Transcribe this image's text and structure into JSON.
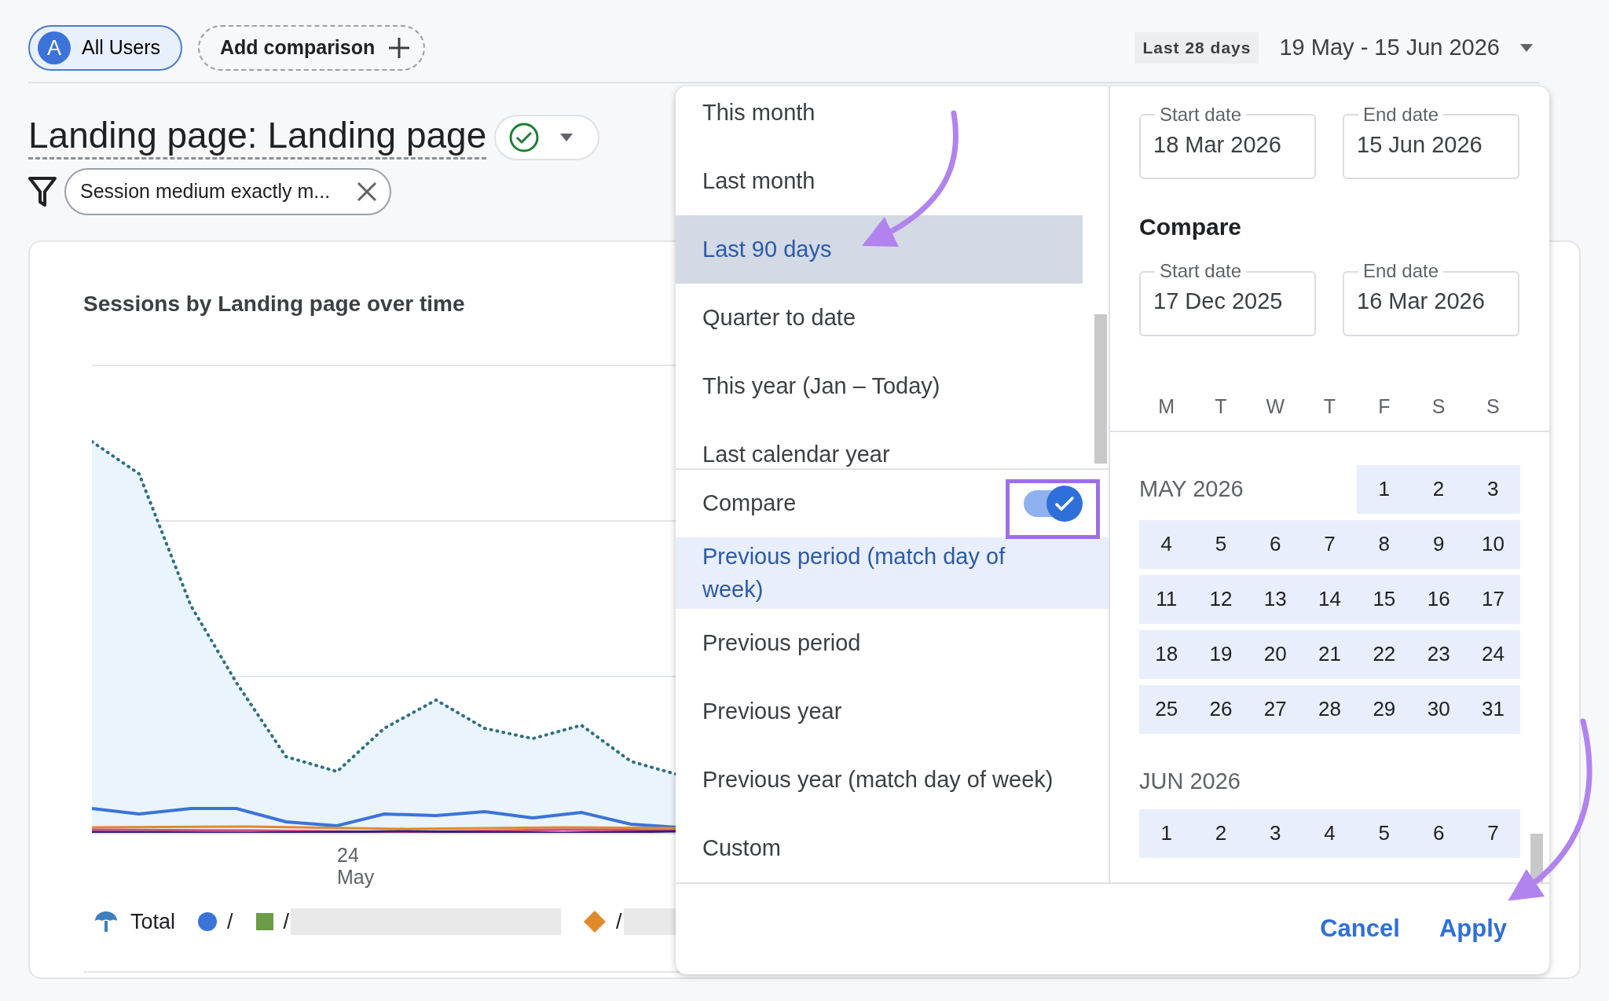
{
  "header": {
    "segment": {
      "avatar": "A",
      "label": "All Users",
      "selected": true
    },
    "add_comparison": "Add comparison",
    "date_range": {
      "preset": "Last 28 days",
      "range": "19 May - 15 Jun 2026"
    }
  },
  "report": {
    "title": "Landing page: Landing page",
    "filter": "Session medium exactly m..."
  },
  "chart_card": {
    "title": "Sessions by Landing page over time",
    "x_labels": [
      {
        "day": "24",
        "month": "May"
      }
    ],
    "legend": [
      {
        "kind": "total",
        "label": "Total",
        "color": "#3d7fbf",
        "redacted": false
      },
      {
        "kind": "circle",
        "label": "/",
        "color": "#3b73d9",
        "redacted": false
      },
      {
        "kind": "square",
        "label": "/",
        "color": "#6b9d47",
        "redacted": true
      },
      {
        "kind": "diamond",
        "label": "/",
        "color": "#e08a2c",
        "redacted": true
      }
    ]
  },
  "date_picker": {
    "presets": [
      {
        "label": "This month",
        "selected": false
      },
      {
        "label": "Last month",
        "selected": false
      },
      {
        "label": "Last 90 days",
        "selected": true
      },
      {
        "label": "Quarter to date",
        "selected": false
      },
      {
        "label": "This year (Jan – Today)",
        "selected": false
      },
      {
        "label": "Last calendar year",
        "selected": false
      }
    ],
    "compare": {
      "label": "Compare",
      "on": true
    },
    "compare_options": [
      {
        "label": "Previous period (match day of week)",
        "selected": true
      },
      {
        "label": "Previous period",
        "selected": false
      },
      {
        "label": "Previous year",
        "selected": false
      },
      {
        "label": "Previous year (match day of week)",
        "selected": false
      },
      {
        "label": "Custom",
        "selected": false
      }
    ],
    "range": {
      "start_label": "Start date",
      "start": "18 Mar 2026",
      "end_label": "End date",
      "end": "15 Jun 2026"
    },
    "compare_heading": "Compare",
    "compare_range": {
      "start_label": "Start date",
      "start": "17 Dec 2025",
      "end_label": "End date",
      "end": "16 Mar 2026"
    },
    "weekdays": [
      "M",
      "T",
      "W",
      "T",
      "F",
      "S",
      "S"
    ],
    "months": [
      {
        "name": "MAY 2026",
        "weeks": [
          {
            "days": [
              "1",
              "2",
              "3"
            ],
            "in_range": true
          },
          {
            "days": [
              "4",
              "5",
              "6",
              "7",
              "8",
              "9",
              "10"
            ],
            "in_range": true
          },
          {
            "days": [
              "11",
              "12",
              "13",
              "14",
              "15",
              "16",
              "17"
            ],
            "in_range": true
          },
          {
            "days": [
              "18",
              "19",
              "20",
              "21",
              "22",
              "23",
              "24"
            ],
            "in_range": true
          },
          {
            "days": [
              "25",
              "26",
              "27",
              "28",
              "29",
              "30",
              "31"
            ],
            "in_range": true
          }
        ]
      },
      {
        "name": "JUN 2026",
        "weeks": [
          {
            "days": [
              "1",
              "2",
              "3",
              "4",
              "5",
              "6",
              "7"
            ],
            "in_range": true
          }
        ]
      }
    ],
    "buttons": {
      "cancel": "Cancel",
      "apply": "Apply"
    }
  }
}
